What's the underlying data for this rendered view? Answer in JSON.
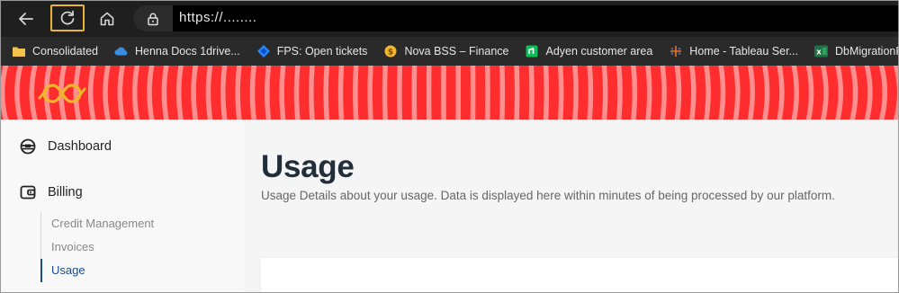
{
  "browser": {
    "address": "https://........",
    "icons": [
      "back-arrow-icon",
      "reload-icon",
      "home-icon",
      "lock-icon"
    ]
  },
  "bookmarks": [
    {
      "label": "Consolidated",
      "icon": "folder-icon",
      "color": "#f2c14e"
    },
    {
      "label": "Henna Docs 1drive...",
      "icon": "onedrive-cloud-icon",
      "color": "#3b8de0"
    },
    {
      "label": "FPS: Open tickets",
      "icon": "jira-icon",
      "color": "#2684ff"
    },
    {
      "label": "Nova BSS – Finance",
      "icon": "coin-icon",
      "color": "#f3b52b"
    },
    {
      "label": "Adyen customer area",
      "icon": "adyen-icon",
      "color": "#0abf53"
    },
    {
      "label": "Home - Tableau Ser...",
      "icon": "tableau-icon",
      "color": "#e97627"
    },
    {
      "label": "DbMigrationPreBil",
      "icon": "excel-icon",
      "color": "#1f7244"
    }
  ],
  "banner": {
    "stripe_color": "#ff2d2d",
    "light_color": "#ff8f8f",
    "logo_color": "#f3b52b"
  },
  "sidebar": {
    "items": [
      {
        "label": "Dashboard",
        "icon": "dashboard-icon"
      },
      {
        "label": "Billing",
        "icon": "wallet-icon"
      }
    ],
    "billing_sub": [
      "Credit Management",
      "Invoices",
      "Usage"
    ],
    "active_sub": "Usage"
  },
  "main": {
    "title": "Usage",
    "subtitle": "Usage Details about your usage. Data is displayed here within minutes of being processed by our platform."
  }
}
